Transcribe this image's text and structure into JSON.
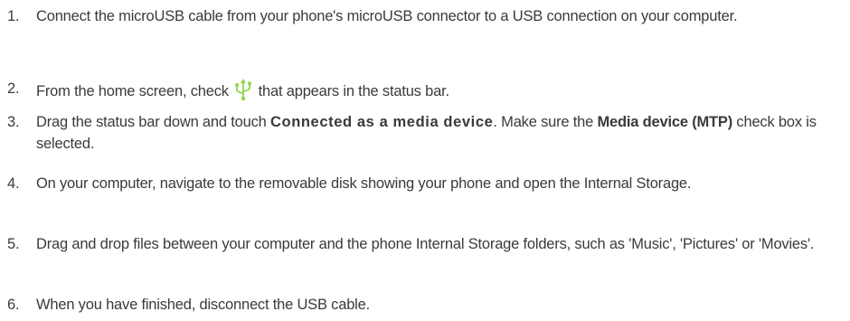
{
  "steps": [
    {
      "number": "1.",
      "text": "Connect the microUSB cable from your phone's microUSB connector to a USB connection on your computer."
    },
    {
      "number": "2.",
      "text_before_icon": "From the home screen, check",
      "icon": "usb-icon",
      "text_after_icon": "that appears in the status bar."
    },
    {
      "number": "3.",
      "part1": "Drag the status bar down and touch ",
      "bold1": "Connected as a media device",
      "part2": ". Make sure the ",
      "bold2": "Media device (MTP)",
      "part3": " check box is selected."
    },
    {
      "number": "4.",
      "text": "On your computer, navigate to the removable disk showing your phone and open the Internal Storage."
    },
    {
      "number": "5.",
      "text": "Drag and drop files between your computer and the phone Internal Storage folders, such as 'Music', 'Pictures' or 'Movies'."
    },
    {
      "number": "6.",
      "text": "When you have finished, disconnect the USB cable."
    }
  ],
  "colors": {
    "text": "#3a3a3a",
    "icon": "#8fd44a"
  }
}
